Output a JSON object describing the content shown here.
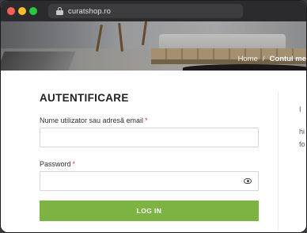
{
  "browser": {
    "url": "curatshop.ro"
  },
  "breadcrumb": {
    "home": "Home",
    "separator": "/",
    "current": "Contul me"
  },
  "login": {
    "title": "AUTENTIFICARE",
    "username_label": "Nume utilizator sau adresă email",
    "username_value": "",
    "password_label": "Password",
    "password_value": "",
    "required_mark": "*",
    "button_label": "LOG IN"
  },
  "side_column": {
    "lines": [
      "I",
      "hi",
      "fo"
    ]
  },
  "colors": {
    "accent_button": "#7cb342",
    "required": "#d83a3a",
    "titlebar": "#2b2b2d"
  },
  "icons": [
    "lock-icon",
    "eye-icon"
  ]
}
